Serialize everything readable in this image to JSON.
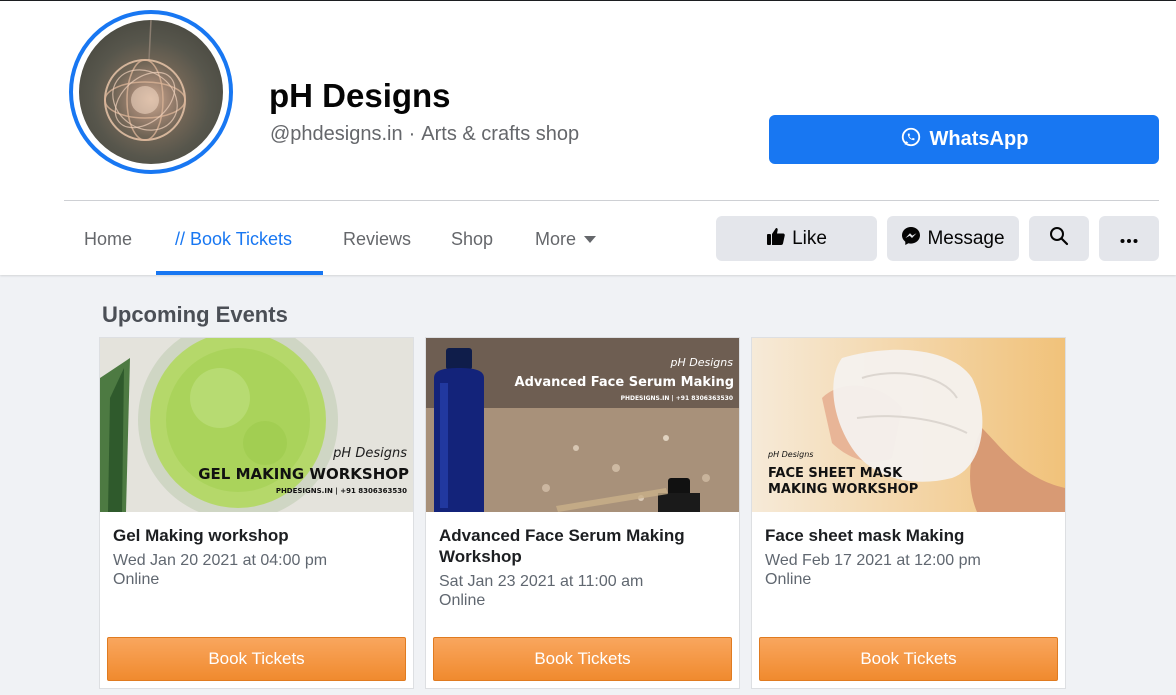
{
  "page": {
    "name": "pH Designs",
    "handle": "@phdesigns.in",
    "separator": "·",
    "category": "Arts & crafts shop"
  },
  "actions": {
    "whatsapp_label": "WhatsApp",
    "like_label": "Like",
    "message_label": "Message"
  },
  "tabs": [
    {
      "label": "Home"
    },
    {
      "label": "// Book Tickets"
    },
    {
      "label": "Reviews"
    },
    {
      "label": "Shop"
    },
    {
      "label": "More"
    }
  ],
  "events_section": {
    "title": "Upcoming Events",
    "events": [
      {
        "name": "Gel Making workshop",
        "date": "Wed Jan 20 2021 at 04:00 pm",
        "location": "Online",
        "button": "Book Tickets",
        "image_text": {
          "brand": "pH Designs",
          "headline": "GEL MAKING WORKSHOP",
          "contact": "PHDESIGNS.IN | +91 8306363530"
        }
      },
      {
        "name": "Advanced Face Serum Making Workshop",
        "date": "Sat Jan 23 2021 at 11:00 am",
        "location": "Online",
        "button": "Book Tickets",
        "image_text": {
          "brand": "pH Designs",
          "headline": "Advanced Face Serum Making",
          "contact": "PHDESIGNS.IN | +91 8306363530"
        }
      },
      {
        "name": "Face sheet mask Making",
        "date": "Wed Feb 17 2021 at 12:00 pm",
        "location": "Online",
        "button": "Book Tickets",
        "image_text": {
          "brand": "pH Designs",
          "headline_line1": "FACE SHEET MASK",
          "headline_line2": "MAKING WORKSHOP"
        }
      }
    ]
  },
  "colors": {
    "brand_blue": "#1877f2",
    "book_button": "#f08a2e",
    "page_background": "#f0f2f5"
  },
  "icons": [
    "whatsapp-icon",
    "like-icon",
    "messenger-icon",
    "search-icon",
    "more-options-icon",
    "caret-down-icon"
  ]
}
